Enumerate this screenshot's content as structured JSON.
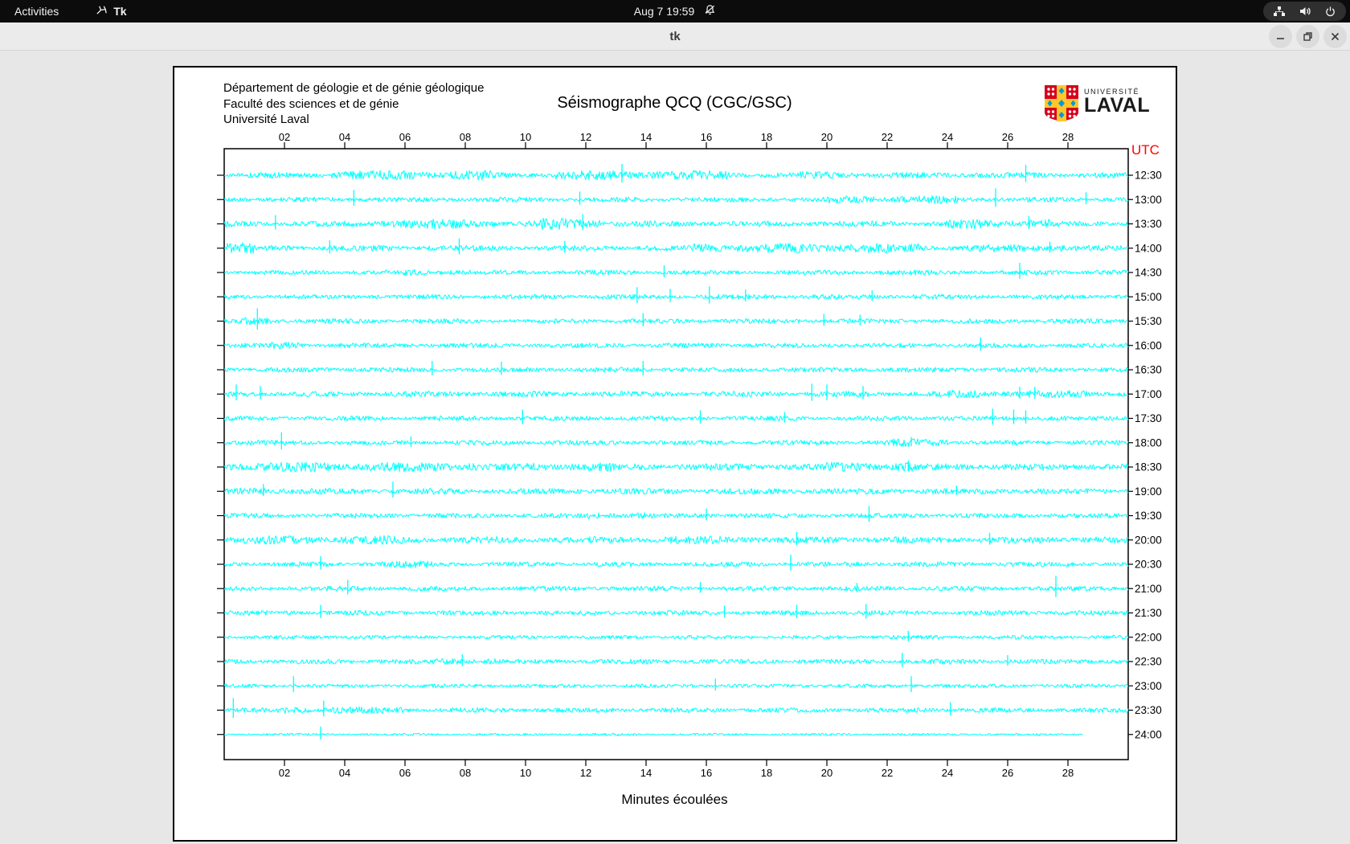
{
  "top_bar": {
    "activities_label": "Activities",
    "app_name": "Tk",
    "clock": "Aug 7 19:59",
    "icons": {
      "tk": "tk-icon",
      "notifications": "notifications-muted-icon",
      "network": "network-icon",
      "volume": "volume-icon",
      "power": "power-icon"
    }
  },
  "title_bar": {
    "title": "tk",
    "buttons": [
      "minimize",
      "maximize",
      "close"
    ]
  },
  "canvas": {
    "header_line1": "Département de géologie et de génie géologique",
    "header_line2": "Faculté des sciences et de génie",
    "header_line3": "Université Laval",
    "logo_line1": "UNIVERSITÉ",
    "logo_line2": "LAVAL",
    "utc_label": "UTC"
  },
  "chart_data": {
    "type": "line",
    "title": "Séismographe QCQ (CGC/GSC)",
    "xlabel": "Minutes écoulées",
    "ylabel_right": "UTC",
    "x_range_minutes": [
      0,
      30
    ],
    "x_ticks": [
      "02",
      "04",
      "06",
      "08",
      "10",
      "12",
      "14",
      "16",
      "18",
      "20",
      "22",
      "24",
      "26",
      "28"
    ],
    "grid": false,
    "trace_color": "#00ffff",
    "frame_color": "#000000",
    "utc_color": "#ff0000",
    "row_spacing_px": 30.25,
    "rows": [
      {
        "label": "12:30",
        "base": 3,
        "bursts": [
          [
            3.5,
            9,
            5
          ],
          [
            11,
            17,
            5
          ],
          [
            19,
            21,
            4
          ]
        ],
        "spikes": [
          [
            13.2,
            14
          ],
          [
            26.6,
            13
          ]
        ],
        "end_min": 30
      },
      {
        "label": "13:00",
        "base": 2.5,
        "bursts": [
          [
            20,
            24.5,
            4
          ]
        ],
        "spikes": [
          [
            4.3,
            12
          ],
          [
            11.8,
            10
          ],
          [
            25.6,
            14
          ],
          [
            28.6,
            9
          ]
        ],
        "end_min": 30
      },
      {
        "label": "13:30",
        "base": 3,
        "bursts": [
          [
            5,
            9,
            5
          ],
          [
            10.5,
            12.5,
            6
          ],
          [
            24,
            27.5,
            5
          ]
        ],
        "spikes": [
          [
            1.7,
            11
          ],
          [
            11.9,
            12
          ],
          [
            26.7,
            10
          ]
        ],
        "end_min": 30
      },
      {
        "label": "14:00",
        "base": 3,
        "bursts": [
          [
            0,
            1,
            6
          ],
          [
            15.5,
            23.5,
            5
          ],
          [
            25,
            28,
            4
          ]
        ],
        "spikes": [
          [
            3.5,
            10
          ],
          [
            7.8,
            12
          ],
          [
            11.3,
            9
          ],
          [
            27.4,
            8
          ]
        ],
        "end_min": 30
      },
      {
        "label": "14:30",
        "base": 2.5,
        "bursts": [
          [
            6,
            8,
            3.5
          ]
        ],
        "spikes": [
          [
            14.6,
            9
          ],
          [
            26.4,
            12
          ]
        ],
        "end_min": 30
      },
      {
        "label": "15:00",
        "base": 2.5,
        "bursts": [],
        "spikes": [
          [
            13.7,
            12
          ],
          [
            14.8,
            10
          ],
          [
            16.1,
            13
          ],
          [
            17.3,
            9
          ],
          [
            21.5,
            8
          ]
        ],
        "end_min": 30
      },
      {
        "label": "15:30",
        "base": 2.5,
        "bursts": [
          [
            0.5,
            1.5,
            4
          ]
        ],
        "spikes": [
          [
            1.1,
            16
          ],
          [
            13.9,
            10
          ],
          [
            19.9,
            9
          ],
          [
            21.1,
            8
          ]
        ],
        "end_min": 30
      },
      {
        "label": "16:00",
        "base": 2.5,
        "bursts": [
          [
            1.5,
            2.5,
            4
          ]
        ],
        "spikes": [
          [
            25.1,
            10
          ]
        ],
        "end_min": 30
      },
      {
        "label": "16:30",
        "base": 2.5,
        "bursts": [],
        "spikes": [
          [
            6.9,
            11
          ],
          [
            9.2,
            10
          ],
          [
            13.9,
            11
          ]
        ],
        "end_min": 30
      },
      {
        "label": "17:00",
        "base": 3,
        "bursts": [
          [
            24,
            29,
            4
          ]
        ],
        "spikes": [
          [
            0.4,
            12
          ],
          [
            1.2,
            10
          ],
          [
            19.5,
            13
          ],
          [
            20,
            12
          ],
          [
            21.2,
            10
          ],
          [
            26.4,
            9
          ],
          [
            26.9,
            9
          ]
        ],
        "end_min": 30
      },
      {
        "label": "17:30",
        "base": 2.5,
        "bursts": [],
        "spikes": [
          [
            9.9,
            11
          ],
          [
            15.8,
            10
          ],
          [
            18.6,
            8
          ],
          [
            25.5,
            12
          ],
          [
            26.2,
            11
          ],
          [
            26.6,
            10
          ]
        ],
        "end_min": 30
      },
      {
        "label": "18:00",
        "base": 2.5,
        "bursts": [
          [
            22,
            24,
            4
          ]
        ],
        "spikes": [
          [
            1.9,
            13
          ],
          [
            6.2,
            8
          ],
          [
            22.8,
            7
          ]
        ],
        "end_min": 30
      },
      {
        "label": "18:30",
        "base": 3.5,
        "bursts": [
          [
            0,
            8.5,
            5
          ],
          [
            10,
            13,
            4.5
          ],
          [
            20,
            23,
            5
          ]
        ],
        "spikes": [
          [
            22.7,
            8
          ]
        ],
        "end_min": 30
      },
      {
        "label": "19:00",
        "base": 3,
        "bursts": [
          [
            0.5,
            2,
            4
          ]
        ],
        "spikes": [
          [
            1.3,
            9
          ],
          [
            5.6,
            12
          ],
          [
            24.3,
            7
          ]
        ],
        "end_min": 30
      },
      {
        "label": "19:30",
        "base": 2.5,
        "bursts": [
          [
            12,
            14,
            3.5
          ]
        ],
        "spikes": [
          [
            16,
            9
          ],
          [
            21.4,
            12
          ]
        ],
        "end_min": 30
      },
      {
        "label": "20:00",
        "base": 3.5,
        "bursts": [
          [
            0,
            6,
            4.5
          ],
          [
            14,
            18,
            4
          ]
        ],
        "spikes": [
          [
            19,
            10
          ],
          [
            25.4,
            9
          ]
        ],
        "end_min": 30
      },
      {
        "label": "20:30",
        "base": 2.5,
        "bursts": [
          [
            5,
            7,
            3.5
          ]
        ],
        "spikes": [
          [
            3.2,
            10
          ],
          [
            18.8,
            12
          ]
        ],
        "end_min": 30
      },
      {
        "label": "21:00",
        "base": 2.5,
        "bursts": [],
        "spikes": [
          [
            4.1,
            11
          ],
          [
            15.8,
            8
          ],
          [
            21,
            7
          ],
          [
            27.6,
            16
          ]
        ],
        "end_min": 30
      },
      {
        "label": "21:30",
        "base": 2.5,
        "bursts": [],
        "spikes": [
          [
            3.2,
            10
          ],
          [
            16.6,
            9
          ],
          [
            19,
            10
          ],
          [
            21.3,
            11
          ]
        ],
        "end_min": 30
      },
      {
        "label": "22:00",
        "base": 2,
        "bursts": [],
        "spikes": [
          [
            22.7,
            8
          ]
        ],
        "end_min": 30
      },
      {
        "label": "22:30",
        "base": 2.5,
        "bursts": [
          [
            7,
            9,
            3.5
          ]
        ],
        "spikes": [
          [
            7.9,
            9
          ],
          [
            22.5,
            11
          ],
          [
            26,
            8
          ]
        ],
        "end_min": 30
      },
      {
        "label": "23:00",
        "base": 2,
        "bursts": [],
        "spikes": [
          [
            2.3,
            12
          ],
          [
            16.3,
            9
          ],
          [
            22.8,
            12
          ]
        ],
        "end_min": 30
      },
      {
        "label": "23:30",
        "base": 2.5,
        "bursts": [
          [
            2,
            6,
            3.5
          ]
        ],
        "spikes": [
          [
            0.3,
            15
          ],
          [
            3.3,
            12
          ],
          [
            24.1,
            10
          ]
        ],
        "end_min": 30
      },
      {
        "label": "24:00",
        "base": 1.2,
        "bursts": [],
        "spikes": [
          [
            3.2,
            10
          ]
        ],
        "end_min": 28.5
      }
    ]
  }
}
